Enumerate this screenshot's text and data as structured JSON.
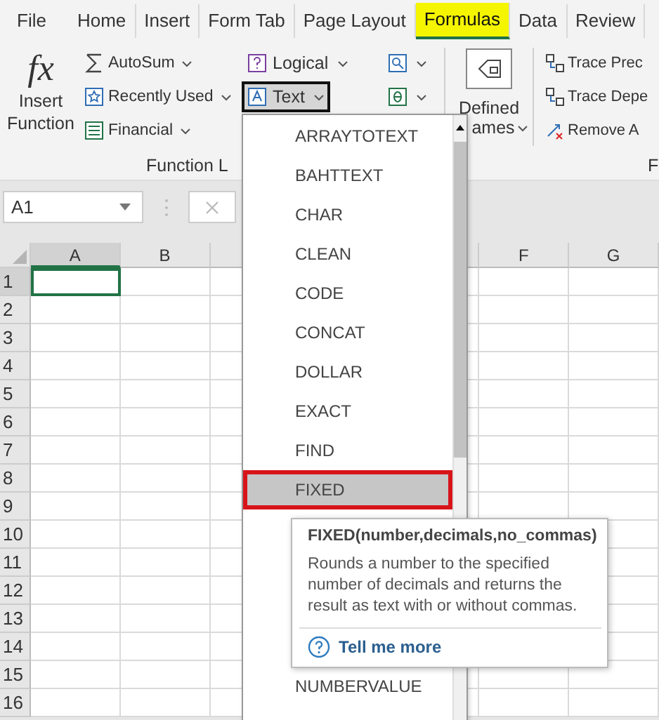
{
  "tabs": [
    {
      "label": "File",
      "selected": false,
      "highlighted": false
    },
    {
      "label": "Home",
      "selected": false,
      "highlighted": false
    },
    {
      "label": "Insert",
      "selected": false,
      "highlighted": false
    },
    {
      "label": "Form Tab",
      "selected": false,
      "highlighted": false
    },
    {
      "label": "Page Layout",
      "selected": false,
      "highlighted": false
    },
    {
      "label": "Formulas",
      "selected": true,
      "highlighted": true
    },
    {
      "label": "Data",
      "selected": false,
      "highlighted": false
    },
    {
      "label": "Review",
      "selected": false,
      "highlighted": false
    }
  ],
  "ribbon": {
    "insert_function": {
      "symbol": "fx",
      "label": "Insert Function"
    },
    "library_buttons": [
      {
        "label": "AutoSum",
        "highlighted": false
      },
      {
        "label": "Recently Used",
        "highlighted": false
      },
      {
        "label": "Financial",
        "highlighted": false
      }
    ],
    "category_buttons": [
      {
        "label": "Logical",
        "highlighted": false
      },
      {
        "label": "Text",
        "highlighted": true
      }
    ],
    "defined_names": {
      "line_1": "Defined",
      "line_2": "ames"
    },
    "auditing_buttons": [
      {
        "label": "Trace Prec"
      },
      {
        "label": "Trace Depe"
      },
      {
        "label": "Remove A"
      }
    ],
    "group_labels": [
      "Function L",
      "F"
    ]
  },
  "formula_bar": {
    "name_box": "A1"
  },
  "grid": {
    "columns": [
      {
        "label": "A",
        "selected": true
      },
      {
        "label": "B",
        "selected": false
      }
    ],
    "columns_right": [
      {
        "label": "F",
        "selected": false
      },
      {
        "label": "G",
        "selected": false
      }
    ],
    "rows": [
      {
        "label": "1",
        "selected": true
      },
      {
        "label": "2",
        "selected": false
      },
      {
        "label": "3",
        "selected": false
      },
      {
        "label": "4",
        "selected": false
      },
      {
        "label": "5",
        "selected": false
      },
      {
        "label": "6",
        "selected": false
      },
      {
        "label": "7",
        "selected": false
      },
      {
        "label": "8",
        "selected": false
      },
      {
        "label": "9",
        "selected": false
      },
      {
        "label": "10",
        "selected": false
      },
      {
        "label": "11",
        "selected": false
      },
      {
        "label": "12",
        "selected": false
      },
      {
        "label": "13",
        "selected": false
      },
      {
        "label": "14",
        "selected": false
      },
      {
        "label": "15",
        "selected": false
      },
      {
        "label": "16",
        "selected": false
      }
    ]
  },
  "dropdown": {
    "items": [
      {
        "label": "ARRAYTOTEXT",
        "selected": false
      },
      {
        "label": "BAHTTEXT",
        "selected": false
      },
      {
        "label": "CHAR",
        "selected": false
      },
      {
        "label": "CLEAN",
        "selected": false
      },
      {
        "label": "CODE",
        "selected": false
      },
      {
        "label": "CONCAT",
        "selected": false
      },
      {
        "label": "DOLLAR",
        "selected": false
      },
      {
        "label": "EXACT",
        "selected": false
      },
      {
        "label": "FIND",
        "selected": false
      },
      {
        "label": "FIXED",
        "selected": true
      }
    ],
    "items_below": [
      {
        "label": "NUMBERVALUE",
        "selected": false
      }
    ]
  },
  "tooltip": {
    "title": "FIXED(number,decimals,no_commas)",
    "description": "Rounds a number to the specified number of decimals and returns the result as text with or without commas.",
    "link": "Tell me more"
  }
}
